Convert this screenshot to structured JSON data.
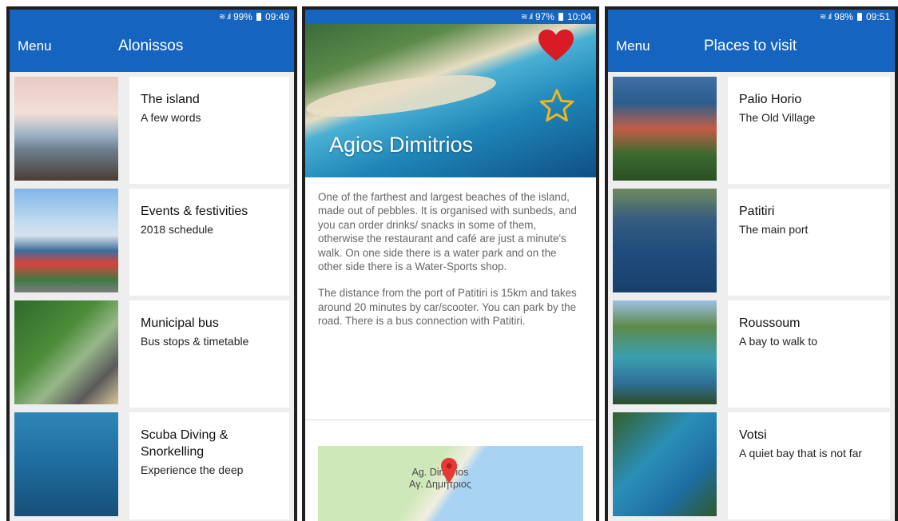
{
  "colors": {
    "primary": "#1565c0",
    "favorite": "#d81b24",
    "star": "#f2b51e"
  },
  "screen1": {
    "status": {
      "battery": "99%",
      "time": "09:49"
    },
    "menu_label": "Menu",
    "title": "Alonissos",
    "items": [
      {
        "title": "The island",
        "subtitle": "A few words"
      },
      {
        "title": "Events & festivities",
        "subtitle": "2018 schedule"
      },
      {
        "title": "Municipal bus",
        "subtitle": "Bus stops & timetable"
      },
      {
        "title": "Scuba Diving & Snorkelling",
        "subtitle": "Experience the deep"
      }
    ]
  },
  "screen2": {
    "status": {
      "battery": "97%",
      "time": "10:04"
    },
    "title": "Agios Dimitrios",
    "icons": {
      "favorite": "heart-icon",
      "rate": "star-icon"
    },
    "paragraphs": [
      "One of the farthest and largest beaches of the island, made out of pebbles. It is organised with sunbeds, and you can order drinks/ snacks in some of them, otherwise the restaurant and café are just a minute's walk. On one side there is a water park and on the other side there is a Water-Sports shop.",
      "The distance from the port of Patitiri is 15km and takes around 20 minutes by car/scooter. You can park by the road. There is a bus connection with Patitiri."
    ],
    "map": {
      "label_latin": "Ag. Dimitrios",
      "label_greek": "Αγ. Δημήτριος"
    }
  },
  "screen3": {
    "status": {
      "battery": "98%",
      "time": "09:51"
    },
    "menu_label": "Menu",
    "title": "Places to visit",
    "items": [
      {
        "title": "Palio Horio",
        "subtitle": "The Old Village"
      },
      {
        "title": "Patitiri",
        "subtitle": "The main port"
      },
      {
        "title": "Roussoum",
        "subtitle": "A bay to walk to"
      },
      {
        "title": "Votsi",
        "subtitle": "A quiet bay that is not far"
      }
    ]
  }
}
